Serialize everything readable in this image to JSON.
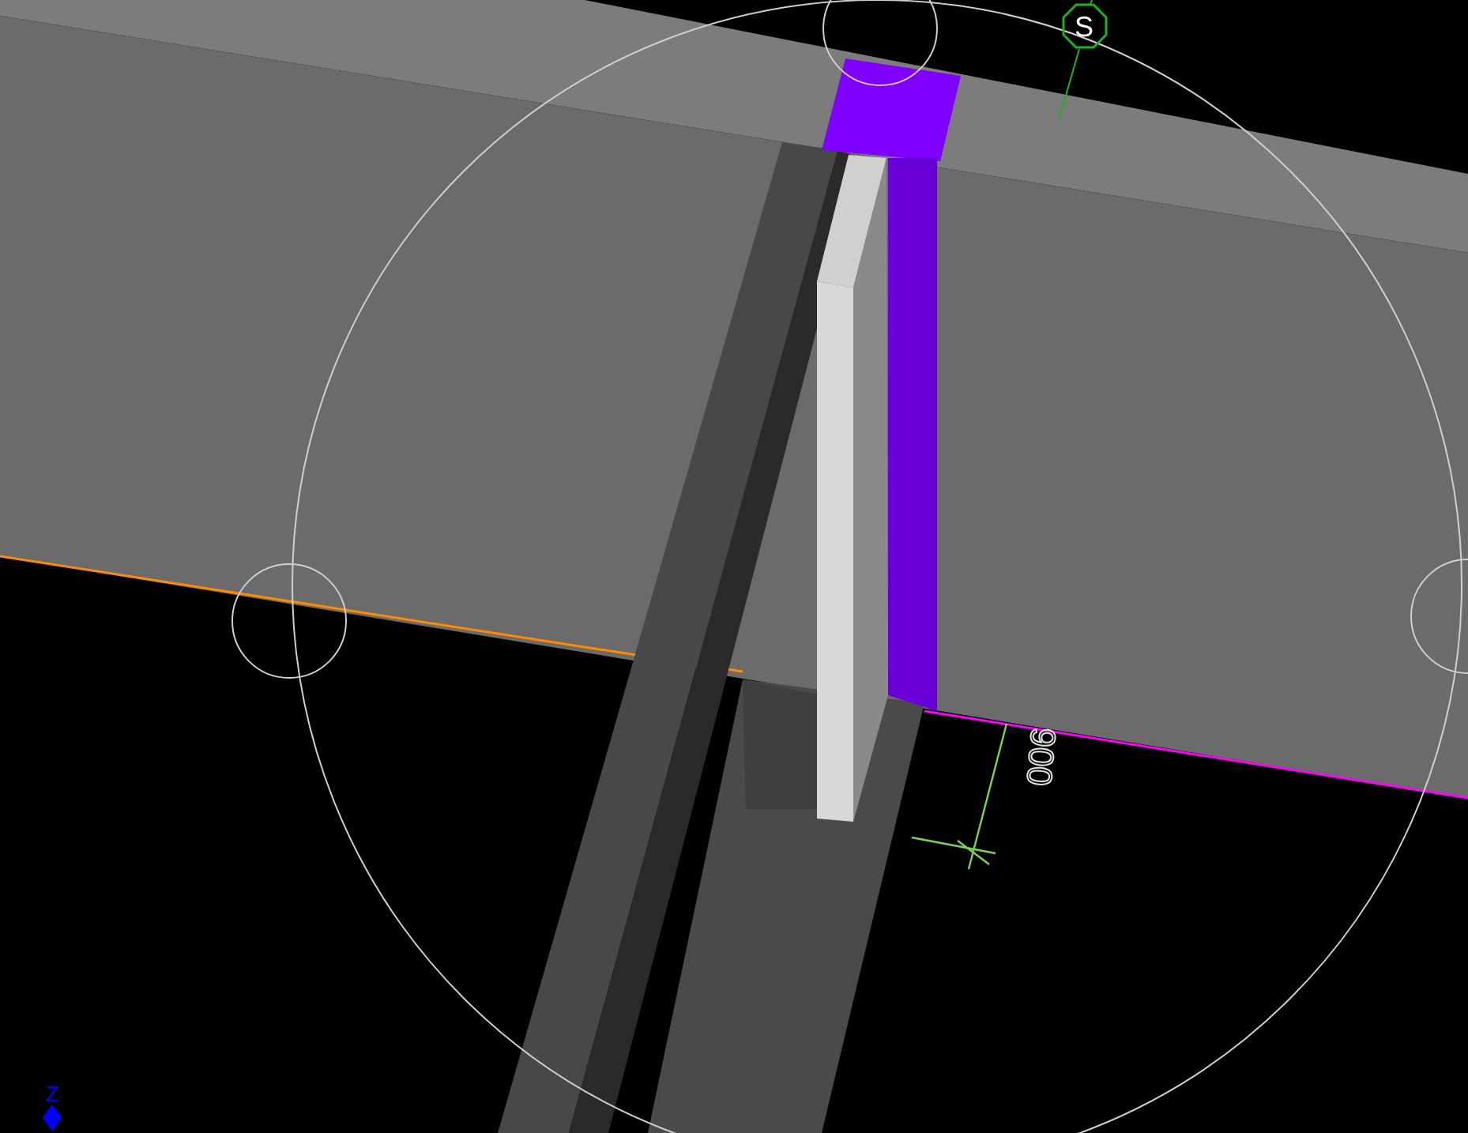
{
  "viewport": {
    "north_marker": "S",
    "dimension": "900",
    "axis_label": "Z"
  }
}
